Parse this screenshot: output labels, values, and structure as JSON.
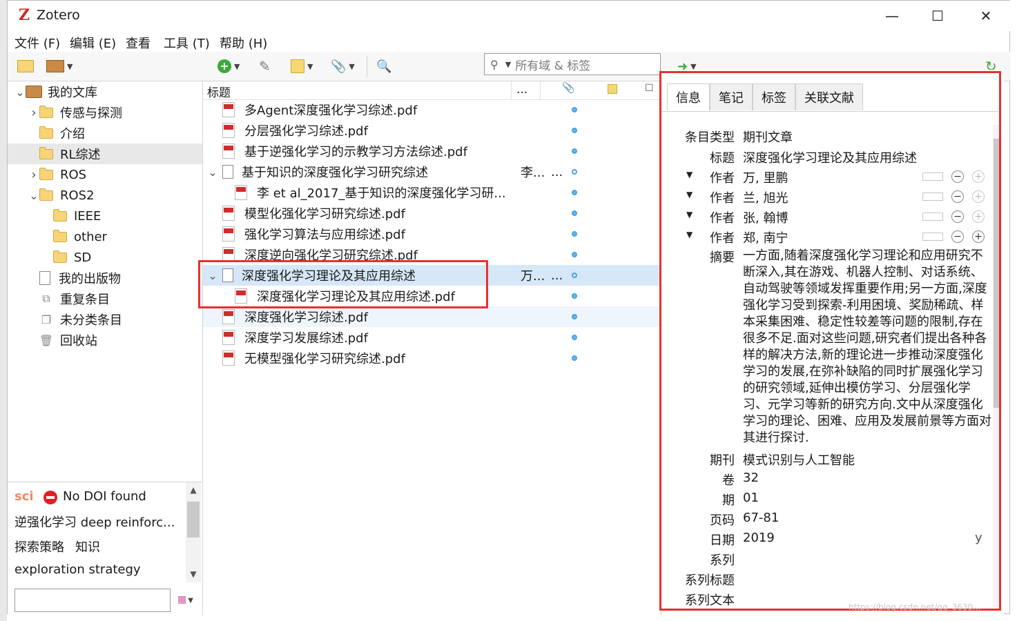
{
  "window": {
    "title": "Zotero",
    "minimize": "—",
    "maximize": "☐",
    "close": "✕"
  },
  "menu": [
    "文件 (F)",
    "编辑 (E)",
    "查看",
    "工具 (T)",
    "帮助 (H)"
  ],
  "search": {
    "placeholder": "所有域 & 标签"
  },
  "collections": [
    {
      "label": "我的文库",
      "type": "library",
      "expanded": true
    },
    {
      "label": "传感与探测",
      "type": "folder",
      "collapsed": true
    },
    {
      "label": "介绍",
      "type": "folder"
    },
    {
      "label": "RL综述",
      "type": "folder",
      "selected": true
    },
    {
      "label": "ROS",
      "type": "folder",
      "collapsed": true
    },
    {
      "label": "ROS2",
      "type": "folder",
      "expanded": true
    },
    {
      "label": "IEEE",
      "type": "folder"
    },
    {
      "label": "other",
      "type": "folder"
    },
    {
      "label": "SD",
      "type": "folder"
    },
    {
      "label": "我的出版物",
      "type": "doc"
    },
    {
      "label": "重复条目",
      "type": "dup"
    },
    {
      "label": "未分类条目",
      "type": "unfiled"
    },
    {
      "label": "回收站",
      "type": "trash"
    }
  ],
  "tags": {
    "sci": "sci",
    "no_doi": "No DOI found",
    "tag1": "逆强化学习 deep reinforc...",
    "tag2": "探索策略",
    "tag3": "知识",
    "tag4": "exploration strategy"
  },
  "columns": {
    "title": "标题",
    "creator": "...",
    "attach": "📎",
    "extra": "☐"
  },
  "items": [
    {
      "title": "多Agent深度强化学习综述.pdf",
      "kind": "pdf",
      "indent": 0
    },
    {
      "title": "分层强化学习综述.pdf",
      "kind": "pdf",
      "indent": 0
    },
    {
      "title": "基于逆强化学习的示教学习方法综述.pdf",
      "kind": "pdf",
      "indent": 0
    },
    {
      "title": "基于知识的深度强化学习研究综述",
      "kind": "doc",
      "indent": 0,
      "expanded": true,
      "creator": "李...",
      "more": "..."
    },
    {
      "title": "李 et al_2017_基于知识的深度强化学习研...",
      "kind": "pdf",
      "indent": 1
    },
    {
      "title": "模型化强化学习研究综述.pdf",
      "kind": "pdf",
      "indent": 0
    },
    {
      "title": "强化学习算法与应用综述.pdf",
      "kind": "pdf",
      "indent": 0
    },
    {
      "title": "深度逆向强化学习研究综述.pdf",
      "kind": "pdf",
      "indent": 0
    },
    {
      "title": "深度强化学习理论及其应用综述",
      "kind": "doc",
      "indent": 0,
      "expanded": true,
      "selected": true,
      "creator": "万...",
      "more": "..."
    },
    {
      "title": "深度强化学习理论及其应用综述.pdf",
      "kind": "pdf",
      "indent": 1
    },
    {
      "title": "深度强化学习综述.pdf",
      "kind": "pdf",
      "indent": 0,
      "alt": true
    },
    {
      "title": "深度学习发展综述.pdf",
      "kind": "pdf",
      "indent": 0
    },
    {
      "title": "无模型强化学习研究综述.pdf",
      "kind": "pdf",
      "indent": 0
    }
  ],
  "tabs": [
    "信息",
    "笔记",
    "标签",
    "关联文献"
  ],
  "info": {
    "item_type_label": "条目类型",
    "item_type": "期刊文章",
    "title_label": "标题",
    "title": "深度强化学习理论及其应用综述",
    "authors_label": "作者",
    "authors": [
      "万, 里鹏",
      "兰, 旭光",
      "张, 翰博",
      "郑, 南宁"
    ],
    "abstract_label": "摘要",
    "abstract": "一方面,随着深度强化学习理论和应用研究不断深入,其在游戏、机器人控制、对话系统、自动驾驶等领域发挥重要作用;另一方面,深度强化学习受到探索-利用困境、奖励稀疏、样本采集困难、稳定性较差等问题的限制,存在很多不足.面对这些问题,研究者们提出各种各样的解决方法,新的理论进一步推动深度强化学习的发展,在弥补缺陷的同时扩展强化学习的研究领域,延伸出模仿学习、分层强化学习、元学习等新的研究方向.文中从深度强化学习的理论、困难、应用及发展前景等方面对其进行探讨.",
    "journal_label": "期刊",
    "journal": "模式识别与人工智能",
    "volume_label": "卷",
    "volume": "32",
    "issue_label": "期",
    "issue": "01",
    "pages_label": "页码",
    "pages": "67-81",
    "date_label": "日期",
    "date": "2019",
    "date_suffix": "y",
    "series_label": "系列",
    "series_title_label": "系列标题",
    "series_text_label": "系列文本"
  },
  "watermark": "https://blog.csdn.net/qq_3630..."
}
